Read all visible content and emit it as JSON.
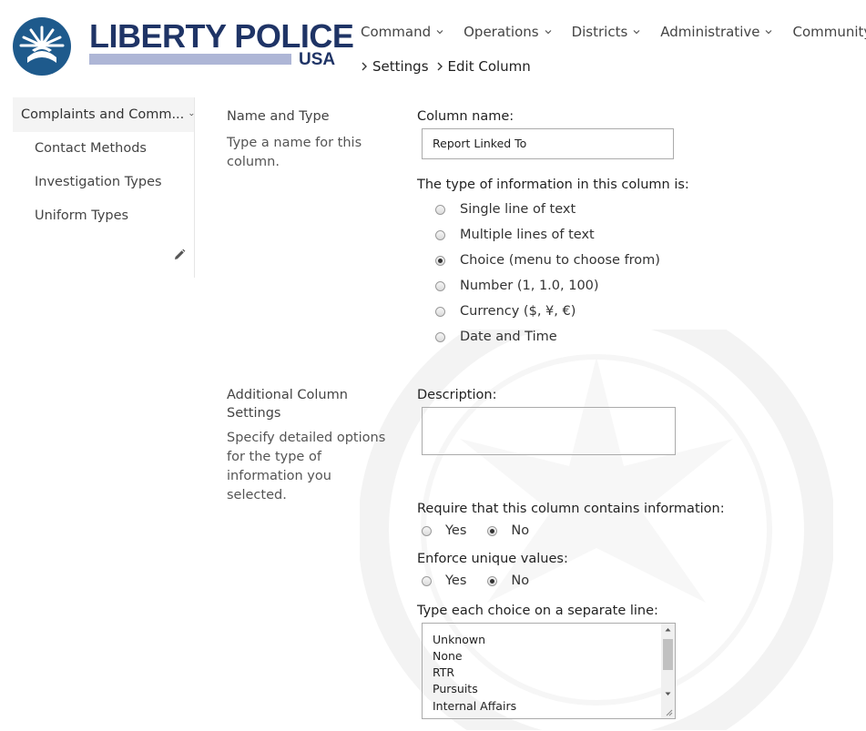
{
  "brand": {
    "title": "LIBERTY POLICE",
    "subtitle": "USA"
  },
  "topnav": [
    {
      "label": "Command"
    },
    {
      "label": "Operations"
    },
    {
      "label": "Districts"
    },
    {
      "label": "Administrative"
    },
    {
      "label": "Community"
    }
  ],
  "breadcrumb": [
    {
      "label": "Settings"
    },
    {
      "label": "Edit Column"
    }
  ],
  "leftnav": {
    "heading": "Complaints and Comm...",
    "items": [
      {
        "label": "Contact Methods"
      },
      {
        "label": "Investigation Types"
      },
      {
        "label": "Uniform Types"
      }
    ]
  },
  "section_name_type": {
    "title": "Name and Type",
    "description": "Type a name for this column.",
    "column_name_label": "Column name:",
    "column_name_value": "Report Linked To",
    "type_label": "The type of information in this column is:",
    "types": [
      {
        "label": "Single line of text",
        "checked": false
      },
      {
        "label": "Multiple lines of text",
        "checked": false
      },
      {
        "label": "Choice (menu to choose from)",
        "checked": true
      },
      {
        "label": "Number (1, 1.0, 100)",
        "checked": false
      },
      {
        "label": "Currency ($, ¥, €)",
        "checked": false
      },
      {
        "label": "Date and Time",
        "checked": false
      }
    ]
  },
  "section_additional": {
    "title": "Additional Column Settings",
    "description": "Specify detailed options for the type of information you selected.",
    "description_label": "Description:",
    "description_value": "",
    "require_label": "Require that this column contains information:",
    "require_options": [
      {
        "label": "Yes",
        "checked": false
      },
      {
        "label": "No",
        "checked": true
      }
    ],
    "unique_label": "Enforce unique values:",
    "unique_options": [
      {
        "label": "Yes",
        "checked": false
      },
      {
        "label": "No",
        "checked": true
      }
    ],
    "choices_label": "Type each choice on a separate line:",
    "choices": [
      "Unknown",
      "None",
      "RTR",
      "Pursuits",
      "Internal Affairs"
    ]
  },
  "colors": {
    "brand_navy": "#1f3466",
    "brand_badge": "#1e5a8c",
    "brand_bar": "#aeb6d6"
  }
}
